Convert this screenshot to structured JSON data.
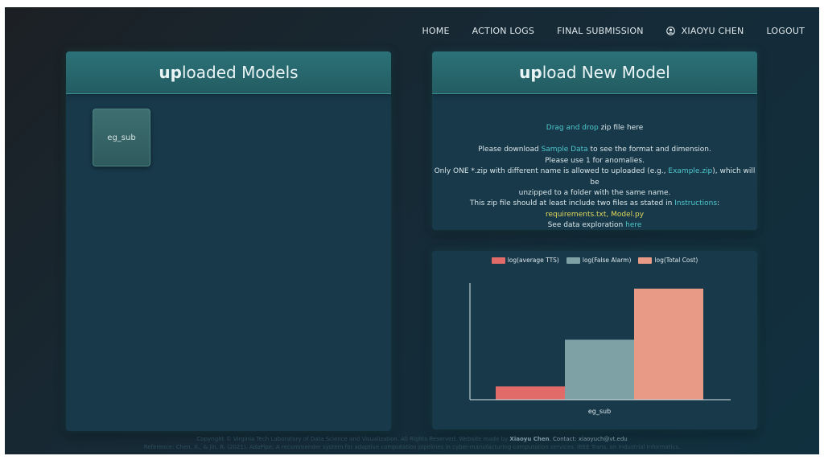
{
  "nav": {
    "home": "HOME",
    "action_logs": "ACTION LOGS",
    "final_submission": "FINAL SUBMISSION",
    "user": "XIAOYU CHEN",
    "logout": "LOGOUT",
    "user_icon": "user-circle-icon"
  },
  "left_panel": {
    "title_bold": "up",
    "title_rest": "loaded Models",
    "models": [
      {
        "name": "eg_sub"
      }
    ]
  },
  "upload_panel": {
    "title_bold": "up",
    "title_rest": "load New Model",
    "drag_link": "Drag and drop",
    "drag_text": " zip file here",
    "line1_pre": "Please download ",
    "line1_link": "Sample Data",
    "line1_post": " to see the format and dimension.",
    "line2": "Please use 1 for anomalies.",
    "line3_pre": "Only ONE *.zip with different name is allowed to uploaded (e.g., ",
    "line3_link": "Example.zip",
    "line3_post": "), which will be",
    "line4": "unzipped to a folder with the same name.",
    "line5_pre": "This zip file should at least include two files as stated in ",
    "line5_link": "Instructions",
    "line5_post": ":",
    "files": "requirements.txt, Model.py",
    "line7_pre": "See data exploration ",
    "line7_link": "here"
  },
  "colors": {
    "accent": "#4fc7cc",
    "highlight_yellow": "#e3d95a"
  },
  "chart_data": {
    "type": "bar",
    "categories": [
      "eg_sub"
    ],
    "series": [
      {
        "name": "log(average TTS)",
        "values": [
          1.2
        ],
        "color": "#e06b68"
      },
      {
        "name": "log(False Alarm)",
        "values": [
          5.4
        ],
        "color": "#7ea1a6"
      },
      {
        "name": "log(Total Cost)",
        "values": [
          10.0
        ],
        "color": "#e89a86"
      }
    ],
    "ylim": [
      0,
      10.5
    ],
    "grid": false,
    "legend": "top"
  },
  "footer": {
    "line1_pre": "Copyright © Virginia Tech Laboratory of Data Science and Visualization. All Rights Reserved. Website made by ",
    "line1_name": "Xiaoyu Chen",
    "line1_mid": ". Contact: ",
    "line1_email": "xiaoyuch@vt.edu",
    "line2": "Reference: Chen, X., & Jin, R. (2021). AdaPipe: A recommender system for adaptive computation pipelines in cyber-manufacturing computation services. IEEE Trans. on Industrial Informatics."
  }
}
